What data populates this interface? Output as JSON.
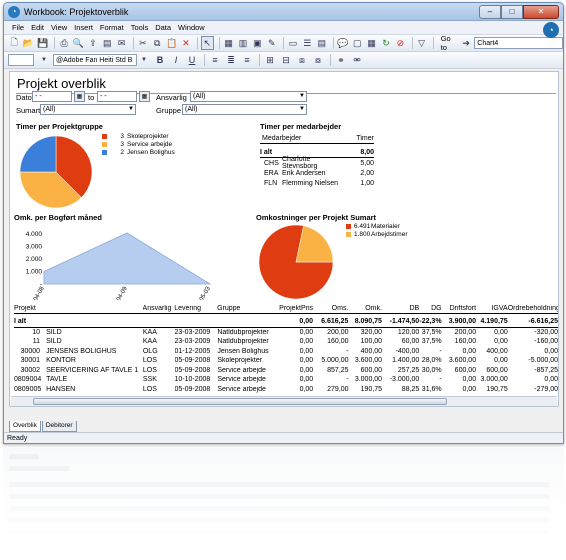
{
  "window": {
    "title": "Workbook: Projektoverblik",
    "buttons": {
      "minimize": "–",
      "maximize": "□",
      "close": "✕"
    }
  },
  "menu": [
    "File",
    "Edit",
    "View",
    "Insert",
    "Format",
    "Tools",
    "Data",
    "Window"
  ],
  "toolbar": {
    "goto_label": "Go to",
    "goto_value": "Chart4",
    "font_name": "@Adobe Fan Heiti Std B",
    "bold": "B",
    "italic": "I",
    "underline": "U"
  },
  "page_title": "Projekt overblik",
  "filters": {
    "dato_label": "Dato",
    "dato_from": "- -",
    "to_label": "to",
    "dato_to": "- -",
    "ansvarlig_label": "Ansvarlig",
    "ansvarlig_value": "(All)",
    "sumart_label": "Sumart",
    "sumart_value": "(All)",
    "gruppe_label": "Gruppe",
    "gruppe_value": "(All)"
  },
  "sections": {
    "timer_gruppe": "Timer per Projektgruppe",
    "timer_medarbejder": "Timer per medarbejder",
    "omk_maaned": "Omk. per Bogført måned",
    "omk_sumart": "Omkostninger per Projekt Sumart"
  },
  "chart_data": [
    {
      "type": "pie",
      "labels": [
        "Skoleprojekter",
        "Service arbejde",
        "Jensen Bolighus"
      ],
      "values": [
        3,
        3,
        2
      ],
      "display_values": [
        "3",
        "3",
        "2"
      ],
      "colors": [
        "#e03c12",
        "#f9b243",
        "#3a7fd9"
      ]
    },
    {
      "type": "area",
      "categories": [
        "2004-08",
        "2004-09",
        "2005-03"
      ],
      "values": [
        1000,
        4100,
        0
      ],
      "ytick_labels": [
        "4.000",
        "3.000",
        "2.000",
        "1.000",
        "-"
      ],
      "ylim": [
        0,
        4500
      ],
      "color": "#b6cdf0",
      "line_color": "#8aa9dc"
    },
    {
      "type": "pie",
      "labels": [
        "Materialer",
        "Arbejdstimer"
      ],
      "values": [
        6491,
        1800
      ],
      "display_values": [
        "6.491",
        "1.800"
      ],
      "colors": [
        "#e03c12",
        "#f9b243"
      ]
    }
  ],
  "employees": {
    "header": [
      "Medarbejder",
      "Timer"
    ],
    "total_label": "I alt",
    "total": "8,00",
    "rows": [
      {
        "init": "CHS",
        "name": "Charlotte Stevnsborg",
        "hours": "5,00"
      },
      {
        "init": "ERA",
        "name": "Erik Andersen",
        "hours": "2,00"
      },
      {
        "init": "FLN",
        "name": "Flemming Nielsen",
        "hours": "1,00"
      }
    ]
  },
  "grid": {
    "headers": [
      "Projekt",
      "Ansvarlig",
      "Levering",
      "Gruppe",
      "ProjektPris",
      "Oms.",
      "Omk.",
      "DB",
      "DG",
      "Driftsfort",
      "IGVA",
      "Ordrebeholdning"
    ],
    "total": [
      "I alt",
      "",
      "",
      "",
      "0,00",
      "6.616,25",
      "8.090,75",
      "-1.474,50",
      "-22,3%",
      "3.900,00",
      "4.190,75",
      "-6.616,25"
    ],
    "rows": [
      [
        "10",
        "SILD",
        "KAA",
        "23-03-2009",
        "Natldubprojekter",
        "0,00",
        "200,00",
        "320,00",
        "120,00",
        "37,5%",
        "200,00",
        "0,00",
        "-320,00"
      ],
      [
        "11",
        "SILD",
        "KAA",
        "23-03-2009",
        "Natldubprojekter",
        "0,00",
        "160,00",
        "100,00",
        "60,00",
        "37,5%",
        "160,00",
        "0,00",
        "-160,00"
      ],
      [
        "30000",
        "JENSENS BOLIGHUS",
        "OLG",
        "01-12-2005",
        "Jensen Bolighus",
        "0,00",
        "-",
        "400,00",
        "-400,00",
        "-",
        "0,00",
        "400,00",
        "0,00"
      ],
      [
        "30001",
        "KONTOR",
        "LOS",
        "05-09-2008",
        "Skoleprojekter",
        "0,00",
        "5.000,00",
        "3.600,00",
        "1.400,00",
        "28,0%",
        "3.600,00",
        "0,00",
        "-5.000,00"
      ],
      [
        "30002",
        "SEERVICERING AF TAVLE 1",
        "LOS",
        "05-09-2008",
        "Service arbejde",
        "0,00",
        "857,25",
        "600,00",
        "257,25",
        "30,0%",
        "600,00",
        "600,00",
        "-857,25"
      ],
      [
        "0809004",
        "TAVLE",
        "SSK",
        "10-10-2008",
        "Service arbejde",
        "0,00",
        "-",
        "3.000,00",
        "-3.000,00",
        "-",
        "0,00",
        "3.000,00",
        "0,00"
      ],
      [
        "0809005",
        "HANSEN",
        "LOS",
        "05-09-2008",
        "Service arbejde",
        "0,00",
        "279,00",
        "190,75",
        "88,25",
        "31,6%",
        "0,00",
        "190,75",
        "-279,00"
      ]
    ]
  },
  "tabs": [
    "Overblik",
    "Debitorer"
  ],
  "status": "Ready"
}
